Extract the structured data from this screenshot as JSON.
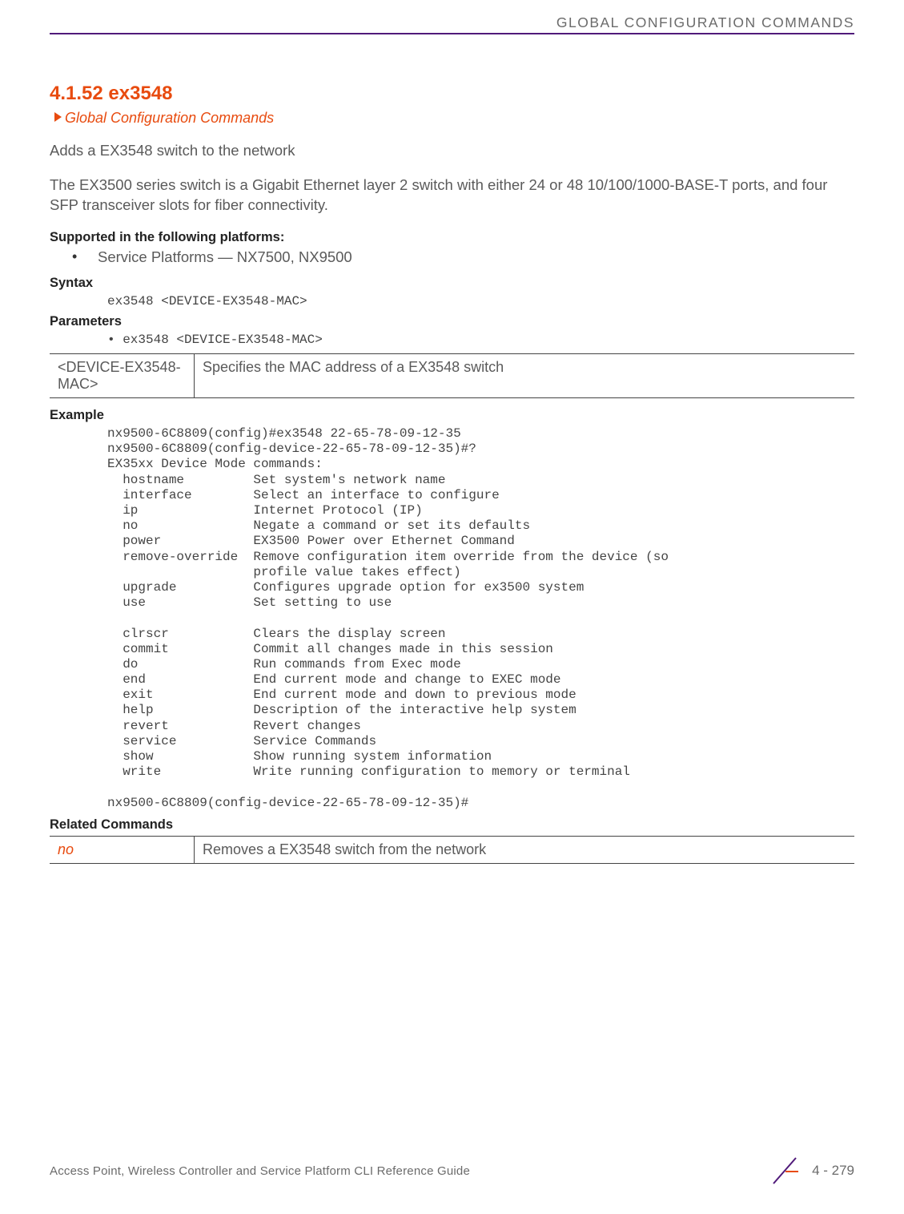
{
  "header": {
    "running_title": "GLOBAL CONFIGURATION COMMANDS"
  },
  "section": {
    "number_title": "4.1.52 ex3548",
    "breadcrumb": "Global Configuration Commands",
    "intro1": "Adds a EX3548 switch to the network",
    "intro2": "The EX3500 series switch is a Gigabit Ethernet layer 2 switch with either 24 or 48 10/100/1000-BASE-T ports, and four SFP transceiver slots for fiber connectivity."
  },
  "supported": {
    "heading": "Supported in the following platforms:",
    "item": "Service Platforms — NX7500, NX9500"
  },
  "syntax": {
    "heading": "Syntax",
    "code": "ex3548 <DEVICE-EX3548-MAC>"
  },
  "parameters": {
    "heading": "Parameters",
    "bullet": "• ex3548 <DEVICE-EX3548-MAC>",
    "table": {
      "name": "<DEVICE-EX3548-MAC>",
      "desc": "Specifies the MAC address of a EX3548 switch"
    }
  },
  "example": {
    "heading": "Example",
    "code": "nx9500-6C8809(config)#ex3548 22-65-78-09-12-35\nnx9500-6C8809(config-device-22-65-78-09-12-35)#?\nEX35xx Device Mode commands:\n  hostname         Set system's network name\n  interface        Select an interface to configure\n  ip               Internet Protocol (IP)\n  no               Negate a command or set its defaults\n  power            EX3500 Power over Ethernet Command\n  remove-override  Remove configuration item override from the device (so\n                   profile value takes effect)\n  upgrade          Configures upgrade option for ex3500 system\n  use              Set setting to use\n\n  clrscr           Clears the display screen\n  commit           Commit all changes made in this session\n  do               Run commands from Exec mode\n  end              End current mode and change to EXEC mode\n  exit             End current mode and down to previous mode\n  help             Description of the interactive help system\n  revert           Revert changes\n  service          Service Commands\n  show             Show running system information\n  write            Write running configuration to memory or terminal\n\nnx9500-6C8809(config-device-22-65-78-09-12-35)#"
  },
  "related": {
    "heading": "Related Commands",
    "table": {
      "cmd": "no",
      "desc": "Removes a EX3548 switch from the network"
    }
  },
  "footer": {
    "guide": "Access Point, Wireless Controller and Service Platform CLI Reference Guide",
    "page": "4 - 279"
  }
}
